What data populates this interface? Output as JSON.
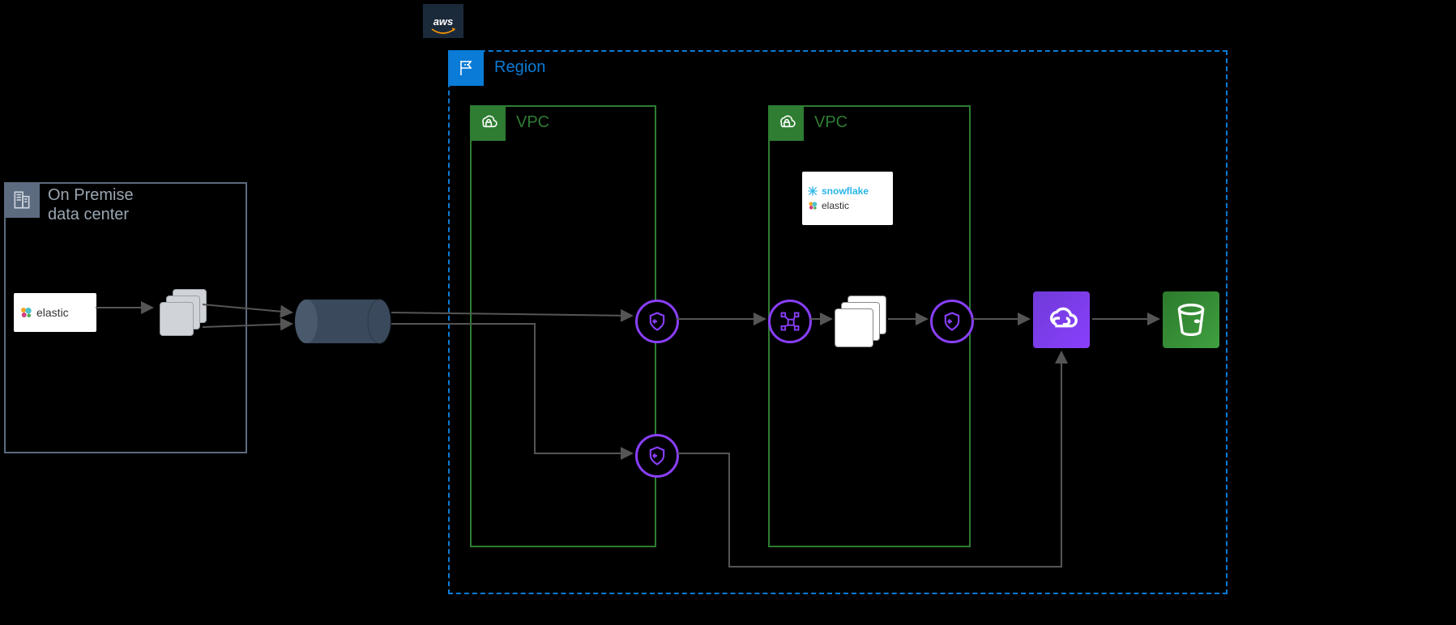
{
  "aws_tag": "aws",
  "onprem": {
    "label": "On Premise\ndata center"
  },
  "region": {
    "label": "Region"
  },
  "vpc1": {
    "label": "VPC"
  },
  "vpc2": {
    "label": "VPC"
  },
  "logos": {
    "elastic_onprem": "elastic",
    "snowflake": "snowflake",
    "elastic_vpc": "elastic"
  },
  "nodes": {
    "vpc_endpoint_top": "VPC Endpoint",
    "vpc_endpoint_bottom": "VPC Endpoint",
    "transit_gateway": "Transit Gateway",
    "compute_stack": "Compute",
    "vpc_endpoint_right": "VPC Endpoint",
    "privatelink": "AWS PrivateLink",
    "s3": "Amazon S3"
  },
  "diagram": {
    "description": "Hybrid architecture: on-premise Elastic cluster connects via AWS Direct Connect into an AWS Region. Inside the Region, VPC 1 exposes VPC endpoints; traffic crosses a Transit Gateway into VPC 2 hosting Snowflake and Elastic workloads, which reach Amazon S3 through AWS PrivateLink. A second path from the lower VPC endpoint also reaches PrivateLink/S3."
  }
}
